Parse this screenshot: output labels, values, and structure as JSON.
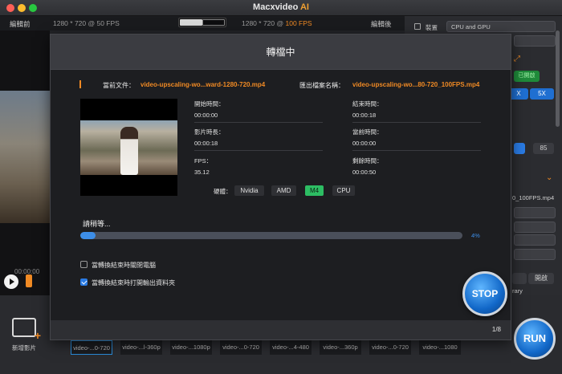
{
  "app": {
    "title_main": "Macxvideo",
    "title_ai": "AI"
  },
  "topstrip": {
    "before_label": "編輯前",
    "before_res": "1280 * 720 @ 50 FPS",
    "after_res_prefix": "1280 * 720 @ ",
    "after_res_fps": "100 FPS",
    "after_label": "編輯後"
  },
  "right_panel": {
    "device_label": "裝置",
    "device_value": "CPU and GPU",
    "chip_x1": "X",
    "chip_5x": "5X",
    "chip_open": "已開啟",
    "value_85": "85",
    "filename": "0_100FPS.mp4",
    "btn_open": "開啟",
    "btn_rary": "rary"
  },
  "background": {
    "time": "00:00:00"
  },
  "bottom": {
    "add_video_label": "新增影片",
    "thumbs": [
      "video-...0-720",
      "video-...l-360p",
      "video-...1080p",
      "video-...0-720",
      "video-...4-480",
      "video-...360p",
      "video-...0-720",
      "video-...1080"
    ]
  },
  "run_label": "RUN",
  "dialog": {
    "title": "轉檔中",
    "current_file_label": "當前文件：",
    "current_file": "video-upscaling-wo...ward-1280-720.mp4",
    "output_name_label": "匯出檔案名稱：",
    "output_name": "video-upscaling-wo...80-720_100FPS.mp4",
    "start_time_label": "開始時間：",
    "start_time": "00:00:00",
    "end_time_label": "結束時間：",
    "end_time": "00:00:18",
    "duration_label": "影片時長：",
    "duration": "00:00:18",
    "current_time_label": "當前時間：",
    "current_time": "00:00:00",
    "fps_label": "FPS：",
    "fps": "35.12",
    "remaining_label": "剩餘時間：",
    "remaining": "00:00:50",
    "hardware_label": "硬體：",
    "hardware": [
      "Nvidia",
      "AMD",
      "M4",
      "CPU"
    ],
    "hardware_active": "M4",
    "wait_text": "請稍等...",
    "progress_percent": 4,
    "progress_text": "4%",
    "option_shutdown": "當轉換結束時關閉電腦",
    "option_shutdown_checked": false,
    "option_open_folder": "當轉換結束時打開輸出資料夾",
    "option_open_folder_checked": true,
    "page_indicator": "1/8",
    "stop_label": "STOP"
  },
  "colors": {
    "accent": "#f08a24",
    "progress": "#3d8ee8",
    "active_hw": "#2dbd63"
  }
}
